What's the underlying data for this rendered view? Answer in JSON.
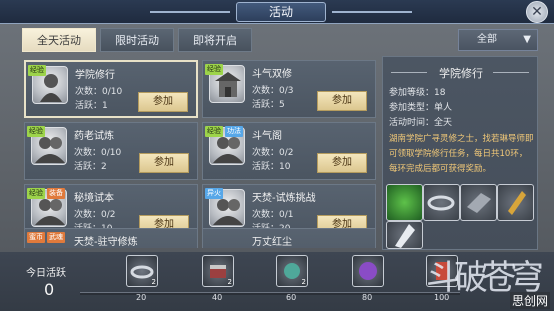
{
  "window": {
    "title": "活动"
  },
  "tabs": [
    {
      "label": "全天活动",
      "active": true
    },
    {
      "label": "限时活动",
      "active": false
    },
    {
      "label": "即将开启",
      "active": false
    }
  ],
  "filter": {
    "selected": "全部"
  },
  "activities": [
    {
      "name": "学院修行",
      "badges": [
        "经验"
      ],
      "count_label": "次数：0/10",
      "activity_label": "活跃：1",
      "button": "参加",
      "selected": true
    },
    {
      "name": "斗气双修",
      "badges": [
        "经验"
      ],
      "count_label": "次数：0/3",
      "activity_label": "活跃：5",
      "button": "参加",
      "selected": false
    },
    {
      "name": "药老试炼",
      "badges": [
        "经验"
      ],
      "count_label": "次数：0/10",
      "activity_label": "活跃：2",
      "button": "参加",
      "selected": false
    },
    {
      "name": "斗气阁",
      "badges": [
        "经验",
        "功法"
      ],
      "count_label": "次数：0/2",
      "activity_label": "活跃：10",
      "button": "参加",
      "selected": false
    },
    {
      "name": "秘境试本",
      "badges": [
        "经验",
        "装备"
      ],
      "count_label": "次数：0/2",
      "activity_label": "活跃：10",
      "button": "参加",
      "selected": false
    },
    {
      "name": "天焚-试炼挑战",
      "badges": [
        "异火"
      ],
      "count_label": "次数：0/1",
      "activity_label": "活跃：20",
      "button": "参加",
      "selected": false
    },
    {
      "name": "天焚-驻守修炼",
      "badges": [
        "蜜币",
        "武魂"
      ],
      "count_label": "",
      "activity_label": "",
      "button": "",
      "selected": false
    },
    {
      "name": "万丈红尘",
      "badges": [],
      "count_label": "",
      "activity_label": "",
      "button": "",
      "selected": false
    }
  ],
  "detail": {
    "title": "学院修行",
    "level": "参加等级：18",
    "type": "参加类型：单人",
    "time": "活动时间：全天",
    "description": "湖南学院广寻灵修之士，找若琳导师即可领取学院修行任务，每日共10环，每环完成后都可获得奖励。"
  },
  "rewards": [
    "jade-disc-icon",
    "silver-ring-icon",
    "crystal-shard-icon",
    "gold-scroll-icon",
    "white-crystal-icon"
  ],
  "daily": {
    "label": "今日活跃",
    "value": "0",
    "progress": 0,
    "milestones": [
      {
        "value": "20",
        "count": "2",
        "icon": "ring-chest-icon"
      },
      {
        "value": "40",
        "count": "2",
        "icon": "box-chest-icon"
      },
      {
        "value": "60",
        "count": "2",
        "icon": "jade-chest-icon"
      },
      {
        "value": "80",
        "count": "",
        "icon": "purple-chest-icon"
      },
      {
        "value": "100",
        "count": "",
        "icon": "scroll-chest-icon"
      }
    ]
  },
  "decoration": {
    "text": "斗破苍穹"
  },
  "watermark": "思创网"
}
